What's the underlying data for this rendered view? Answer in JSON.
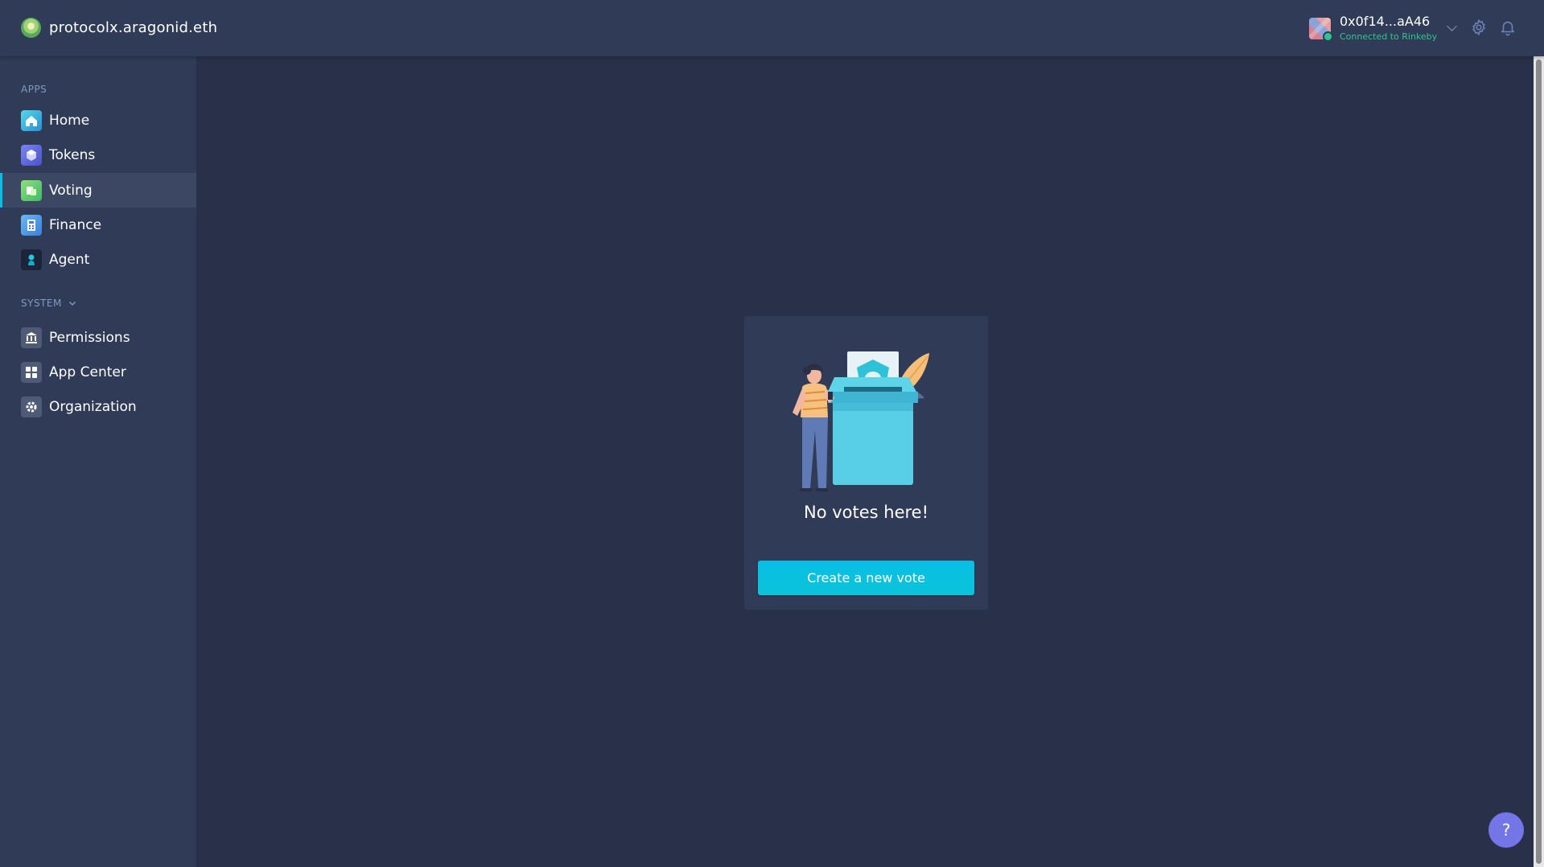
{
  "header": {
    "org_name": "protocolx.aragonid.eth",
    "account": {
      "address": "0x0f14...aA46",
      "network": "Connected to Rinkeby",
      "status_color": "#2cc68f"
    },
    "icons": [
      "settings-icon",
      "notifications-icon"
    ]
  },
  "sidebar": {
    "apps_label": "APPS",
    "system_label": "SYSTEM",
    "apps": [
      {
        "label": "Home",
        "icon": "home-icon"
      },
      {
        "label": "Tokens",
        "icon": "tokens-icon"
      },
      {
        "label": "Voting",
        "icon": "voting-icon",
        "active": true
      },
      {
        "label": "Finance",
        "icon": "finance-icon"
      },
      {
        "label": "Agent",
        "icon": "agent-icon"
      }
    ],
    "system": [
      {
        "label": "Permissions",
        "icon": "permissions-icon"
      },
      {
        "label": "App Center",
        "icon": "app-center-icon"
      },
      {
        "label": "Organization",
        "icon": "organization-icon"
      }
    ]
  },
  "main": {
    "empty_state": {
      "title": "No votes here!",
      "button_label": "Create a new vote"
    }
  },
  "help": {
    "label": "?"
  },
  "colors": {
    "accent": "#08bee5",
    "background": "#283149",
    "surface": "#303c57",
    "help": "#7475e6"
  }
}
